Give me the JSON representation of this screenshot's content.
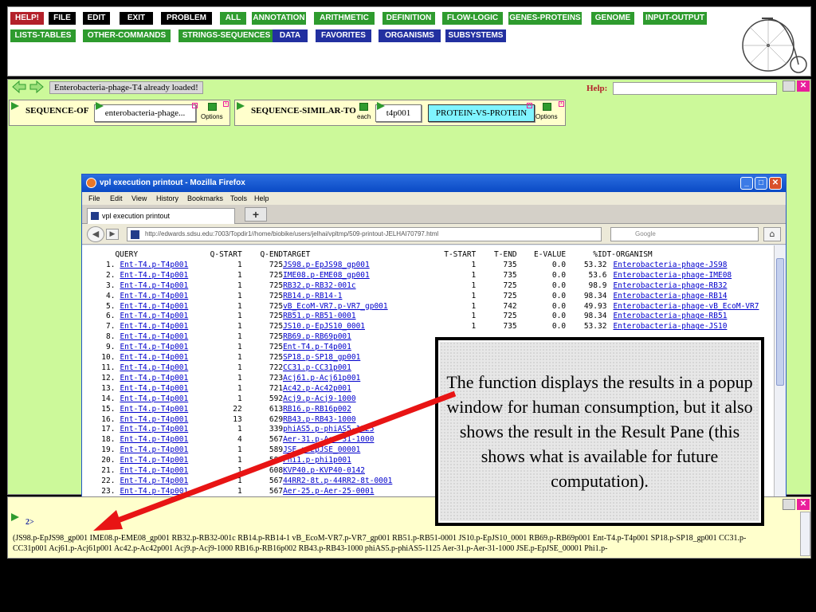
{
  "toolbar": {
    "buttons": [
      {
        "label": "HELP!",
        "color": "red"
      },
      {
        "label": "FILE",
        "color": "black"
      },
      {
        "label": "EDIT",
        "color": "black"
      },
      {
        "label": "EXIT",
        "color": "black"
      },
      {
        "label": "PROBLEM",
        "color": "black"
      },
      {
        "label": "ALL",
        "color": "green"
      },
      {
        "label": "ANNOTATION",
        "color": "green"
      },
      {
        "label": "ARITHMETIC",
        "color": "green"
      },
      {
        "label": "DEFINITION",
        "color": "green"
      },
      {
        "label": "FLOW-LOGIC",
        "color": "green"
      },
      {
        "label": "GENES-PROTEINS",
        "color": "green"
      },
      {
        "label": "GENOME",
        "color": "green"
      },
      {
        "label": "INPUT-OUTPUT",
        "color": "green"
      },
      {
        "label": "LISTS-TABLES",
        "color": "green"
      },
      {
        "label": "OTHER-COMMANDS",
        "color": "green"
      },
      {
        "label": "STRINGS-SEQUENCES",
        "color": "green"
      },
      {
        "label": "DATA",
        "color": "blue"
      },
      {
        "label": "FAVORITES",
        "color": "blue"
      },
      {
        "label": "ORGANISMS",
        "color": "blue"
      },
      {
        "label": "SUBSYSTEMS",
        "color": "blue"
      }
    ],
    "colors": {
      "red": "#b3202a",
      "black": "#000000",
      "green": "#2e9b2e",
      "blue": "#2230a0"
    }
  },
  "workspace": {
    "loaded_message": "Enterobacteria-phage-T4 already loaded!",
    "help_label": "Help:",
    "help_value": "",
    "background": "#ccf99a",
    "block1": {
      "title": "SEQUENCE-OF",
      "slot": "enterobacteria-phage...",
      "options": "Options"
    },
    "block2": {
      "title": "SEQUENCE-SIMILAR-TO",
      "each": "each",
      "slot1": "t4p001",
      "slot2": "PROTEIN-VS-PROTEIN",
      "options": "Options"
    }
  },
  "browser": {
    "title": "vpl execution printout - Mozilla Firefox",
    "menu": [
      "File",
      "Edit",
      "View",
      "History",
      "Bookmarks",
      "Tools",
      "Help"
    ],
    "tab_label": "vpl execution printout",
    "url": "http://edwards.sdsu.edu:7003/Topdir1//home/biobike/users/jelhai/vpltmp/509-printout-JELHAI70797.html",
    "search_placeholder": "Google",
    "table": {
      "headers": [
        "QUERY",
        "Q-START",
        "Q-END",
        "TARGET",
        "T-START",
        "T-END",
        "E-VALUE",
        "%ID",
        "T-ORGANISM"
      ],
      "rows": [
        [
          "1.",
          "Ent-T4.p-T4p001",
          "1",
          "725",
          "JS98.p-EpJS98_gp001",
          "1",
          "735",
          "0.0",
          "53.32",
          "Enterobacteria-phage-JS98"
        ],
        [
          "2.",
          "Ent-T4.p-T4p001",
          "1",
          "725",
          "IME08.p-EME08_gp001",
          "1",
          "735",
          "0.0",
          "53.6",
          "Enterobacteria-phage-IME08"
        ],
        [
          "3.",
          "Ent-T4.p-T4p001",
          "1",
          "725",
          "RB32.p-RB32-001c",
          "1",
          "725",
          "0.0",
          "98.9",
          "Enterobacteria-phage-RB32"
        ],
        [
          "4.",
          "Ent-T4.p-T4p001",
          "1",
          "725",
          "RB14.p-RB14-1",
          "1",
          "725",
          "0.0",
          "98.34",
          "Enterobacteria-phage-RB14"
        ],
        [
          "5.",
          "Ent-T4.p-T4p001",
          "1",
          "725",
          "vB_EcoM-VR7.p-VR7_gp001",
          "1",
          "742",
          "0.0",
          "49.93",
          "Enterobacteria-phage-vB_EcoM-VR7"
        ],
        [
          "6.",
          "Ent-T4.p-T4p001",
          "1",
          "725",
          "RB51.p-RB51-0001",
          "1",
          "725",
          "0.0",
          "98.34",
          "Enterobacteria-phage-RB51"
        ],
        [
          "7.",
          "Ent-T4.p-T4p001",
          "1",
          "725",
          "JS10.p-EpJS10_0001",
          "1",
          "735",
          "0.0",
          "53.32",
          "Enterobacteria-phage-JS10"
        ],
        [
          "8.",
          "Ent-T4.p-T4p001",
          "1",
          "725",
          "RB69.p-RB69p001",
          "",
          "",
          "",
          "",
          ""
        ],
        [
          "9.",
          "Ent-T4.p-T4p001",
          "1",
          "725",
          "Ent-T4.p-T4p001",
          "",
          "",
          "",
          "",
          ""
        ],
        [
          "10.",
          "Ent-T4.p-T4p001",
          "1",
          "725",
          "SP18.p-SP18_gp001",
          "",
          "",
          "",
          "",
          ""
        ],
        [
          "11.",
          "Ent-T4.p-T4p001",
          "1",
          "722",
          "CC31.p-CC31p001",
          "",
          "",
          "",
          "",
          ""
        ],
        [
          "12.",
          "Ent-T4.p-T4p001",
          "1",
          "723",
          "Acj61.p-Acj61p001",
          "",
          "",
          "",
          "",
          ""
        ],
        [
          "13.",
          "Ent-T4.p-T4p001",
          "1",
          "721",
          "Ac42.p-Ac42p001",
          "",
          "",
          "",
          "",
          ""
        ],
        [
          "14.",
          "Ent-T4.p-T4p001",
          "1",
          "592",
          "Acj9.p-Acj9-1000",
          "",
          "",
          "",
          "",
          ""
        ],
        [
          "15.",
          "Ent-T4.p-T4p001",
          "22",
          "613",
          "RB16.p-RB16p002",
          "",
          "",
          "",
          "",
          ""
        ],
        [
          "16.",
          "Ent-T4.p-T4p001",
          "13",
          "629",
          "RB43.p-RB43-1000",
          "",
          "",
          "",
          "",
          ""
        ],
        [
          "17.",
          "Ent-T4.p-T4p001",
          "1",
          "339",
          "phiAS5.p-phiAS5-1125",
          "",
          "",
          "",
          "",
          ""
        ],
        [
          "18.",
          "Ent-T4.p-T4p001",
          "4",
          "567",
          "Aer-31.p-Aer-31-1000",
          "",
          "",
          "",
          "",
          ""
        ],
        [
          "19.",
          "Ent-T4.p-T4p001",
          "1",
          "589",
          "JSE.p-EpJSE_00001",
          "",
          "",
          "",
          "",
          ""
        ],
        [
          "20.",
          "Ent-T4.p-T4p001",
          "1",
          "589",
          "Phi1.p-phi1p001",
          "",
          "",
          "",
          "",
          ""
        ],
        [
          "21.",
          "Ent-T4.p-T4p001",
          "1",
          "608",
          "KVP40.p-KVP40-0142",
          "",
          "",
          "",
          "",
          ""
        ],
        [
          "22.",
          "Ent-T4.p-T4p001",
          "1",
          "567",
          "44RR2-8t.p-44RR2-8t-0001",
          "",
          "",
          "",
          "",
          ""
        ],
        [
          "23.",
          "Ent-T4.p-T4p001",
          "1",
          "567",
          "Aer-25.p-Aer-25-0001",
          "",
          "",
          "",
          "",
          ""
        ]
      ]
    }
  },
  "result_pane": {
    "prompt": "2>",
    "text": "(JS98.p-EpJS98_gp001 IME08.p-EME08_gp001 RB32.p-RB32-001c RB14.p-RB14-1 vB_EcoM-VR7.p-VR7_gp001 RB51.p-RB51-0001 JS10.p-EpJS10_0001 RB69.p-RB69p001 Ent-T4.p-T4p001 SP18.p-SP18_gp001 CC31.p-CC31p001 Acj61.p-Acj61p001 Ac42.p-Ac42p001 Acj9.p-Acj9-1000 RB16.p-RB16p002 RB43.p-RB43-1000 phiAS5.p-phiAS5-1125 Aer-31.p-Aer-31-1000 JSE.p-EpJSE_00001 Phi1.p-"
  },
  "callout": {
    "text": "The function displays the results in a popup window for human consumption, but it also shows the result in the Result Pane (this shows what is available for future computation)."
  }
}
